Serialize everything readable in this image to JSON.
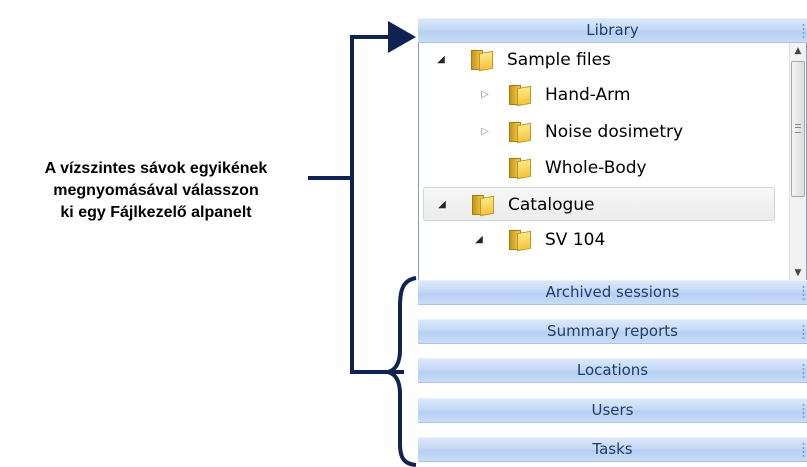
{
  "annotation": {
    "lines": [
      "A vízszintes sávok egyikének",
      "megnyomásával válasszon",
      "ki egy Fájlkezelő alpanelt"
    ]
  },
  "library_bar": {
    "label": "Library"
  },
  "tree": {
    "items": [
      {
        "label": "Sample files",
        "expander": "expanded"
      },
      {
        "label": "Hand-Arm",
        "expander": "collapsed"
      },
      {
        "label": "Noise dosimetry",
        "expander": "collapsed"
      },
      {
        "label": "Whole-Body",
        "expander": "none"
      },
      {
        "label": "Catalogue",
        "expander": "expanded",
        "selected": true
      },
      {
        "label": "SV 104",
        "expander": "expanded"
      }
    ]
  },
  "bars": [
    {
      "label": "Archived sessions"
    },
    {
      "label": "Summary reports"
    },
    {
      "label": "Locations"
    },
    {
      "label": "Users"
    },
    {
      "label": "Tasks"
    }
  ],
  "colors": {
    "bar_text": "#1f3d6b",
    "bar_fill": "#c4d9f6",
    "annotation_arrow": "#0f2252"
  }
}
